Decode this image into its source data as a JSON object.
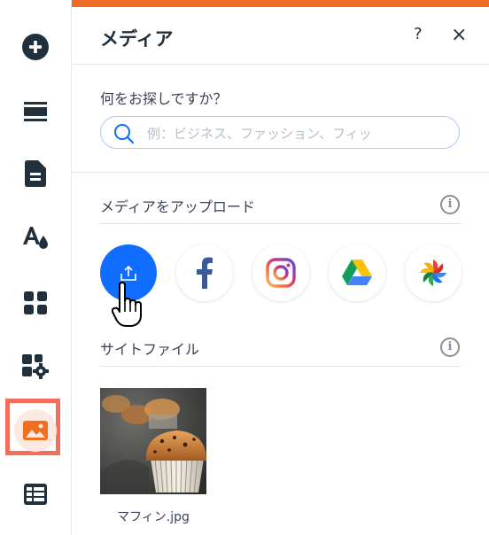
{
  "rail": {
    "items": [
      {
        "name": "add-elements",
        "icon": "plus-circle-icon"
      },
      {
        "name": "sections",
        "icon": "sections-icon"
      },
      {
        "name": "pages",
        "icon": "page-icon"
      },
      {
        "name": "theme",
        "icon": "text-color-icon"
      },
      {
        "name": "apps",
        "icon": "apps-grid-icon"
      },
      {
        "name": "business-apps",
        "icon": "puzzle-gear-icon"
      },
      {
        "name": "media",
        "icon": "image-icon",
        "active": true
      },
      {
        "name": "cms",
        "icon": "table-icon"
      }
    ],
    "active_color": "#f26d5a"
  },
  "panel": {
    "accent_bar_color": "#ee6b25",
    "title": "メディア",
    "help_label": "?",
    "close_label": "×"
  },
  "search": {
    "label": "何をお探しですか？",
    "placeholder": "例：ビジネス、ファッション、フィッ",
    "value": ""
  },
  "upload_section": {
    "label": "メディアをアップロード",
    "sources": [
      {
        "name": "upload",
        "icon": "upload-icon",
        "color": "#116dff"
      },
      {
        "name": "facebook",
        "icon": "facebook-icon",
        "color": "#3b5998"
      },
      {
        "name": "instagram",
        "icon": "instagram-icon"
      },
      {
        "name": "google-drive",
        "icon": "google-drive-icon"
      },
      {
        "name": "google-photos",
        "icon": "google-photos-icon"
      }
    ]
  },
  "site_files": {
    "label": "サイトファイル",
    "files": [
      {
        "name": "マフィン.jpg"
      }
    ]
  }
}
